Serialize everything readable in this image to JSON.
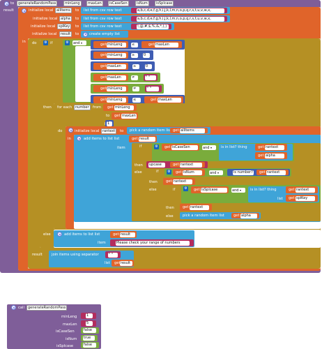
{
  "procedure": {
    "to": "to",
    "name": "generateRandomPass",
    "params": [
      "minLeng",
      "maxLen",
      "isCaseSen",
      "isNum",
      "isSplcase"
    ],
    "result_label": "result"
  },
  "locals": [
    {
      "label": "initialize local",
      "name": "allItems",
      "to": "to",
      "fn": "list from csv row  text",
      "value": "a,b,c,d,e,f,g,h,i,j,k,l,m,n,o,p,q,r,s,t,u,v,w,x,"
    },
    {
      "label": "initialize local",
      "name": "alpha",
      "to": "to",
      "fn": "list from csv row  text",
      "value": "a,b,c,d,e,f,g,h,i,j,k,l,m,n,o,p,q,r,s,t,u,v,w,x,"
    },
    {
      "label": "initialize local",
      "name": "splKey",
      "to": "to",
      "fn": "list from csv row  text",
      "value": "!,@,#,$,%,&,*,(,)"
    },
    {
      "label": "initialize local",
      "name": "result",
      "to": "to",
      "fn": "create empty list",
      "value": ""
    }
  ],
  "in_label": "in",
  "do_label": "do",
  "if_label": "if",
  "and_label": "and",
  "then_label": "then",
  "else_label": "else",
  "get_label": "get",
  "conditions": [
    {
      "left": "minLeng",
      "op": "≤",
      "right": "maxLen"
    },
    {
      "left": "minLeng",
      "op": "≥",
      "right": "0"
    },
    {
      "left": "maxLen",
      "op": "≥",
      "right": "0"
    },
    {
      "left": "maxLen",
      "op": "≠",
      "right": "\" \""
    },
    {
      "left": "minLeng",
      "op": "≠",
      "right": "\" \""
    },
    {
      "left": "minLeng",
      "op": "≤",
      "right": "maxLen"
    }
  ],
  "foreach": {
    "label": "for each",
    "var": "number",
    "from": "from",
    "from_val": "minLeng",
    "to": "to",
    "to_val": "maxLen",
    "by": "by",
    "by_val": "1"
  },
  "inner": {
    "init_label": "initialize local",
    "var": "rantext",
    "to": "to",
    "pick": "pick a random item  list",
    "pick_val": "allItems",
    "in_label": "in",
    "add_label": "add items to list  list",
    "add_list": "result",
    "item_label": "item",
    "if1_left": "isCaseSen",
    "in_list": "is in list? thing",
    "list_label": "list",
    "thing1": "rantext",
    "list1": "alpha",
    "upcase": "upcase",
    "upcase_val": "rantext",
    "if2_left": "isNum",
    "is_number": "is number?",
    "num_val": "rantext",
    "then2_val": "rantext",
    "if3_left": "isSplcase",
    "thing3": "rantext",
    "list3": "splKey",
    "then3_val": "rantext",
    "else3_pick": "pick a random item  list",
    "else3_val": "alpha"
  },
  "else_block": {
    "add_label": "add items to list  list",
    "list": "result",
    "item_label": "item",
    "message": "Please check your range of numbers"
  },
  "result_block": {
    "label": "result",
    "join": "join items using separator",
    "sep": "\" \"",
    "list_label": "list",
    "list_val": "result"
  },
  "call": {
    "label": "call",
    "name": "generateRandomPass",
    "args": [
      {
        "label": "minLeng",
        "value": "1"
      },
      {
        "label": "maxLen",
        "value": "5"
      },
      {
        "label": "isCaseSen",
        "value": "false"
      },
      {
        "label": "isNum",
        "value": "true"
      },
      {
        "label": "isSplcase",
        "value": "false"
      }
    ]
  },
  "colors": {
    "procedure": "#7f5e99",
    "variable": "#e0642a",
    "control": "#b59024",
    "logic": "#7aac3c",
    "list": "#3fa4d8",
    "text": "#b32d5e",
    "math": "#3f5db3"
  }
}
